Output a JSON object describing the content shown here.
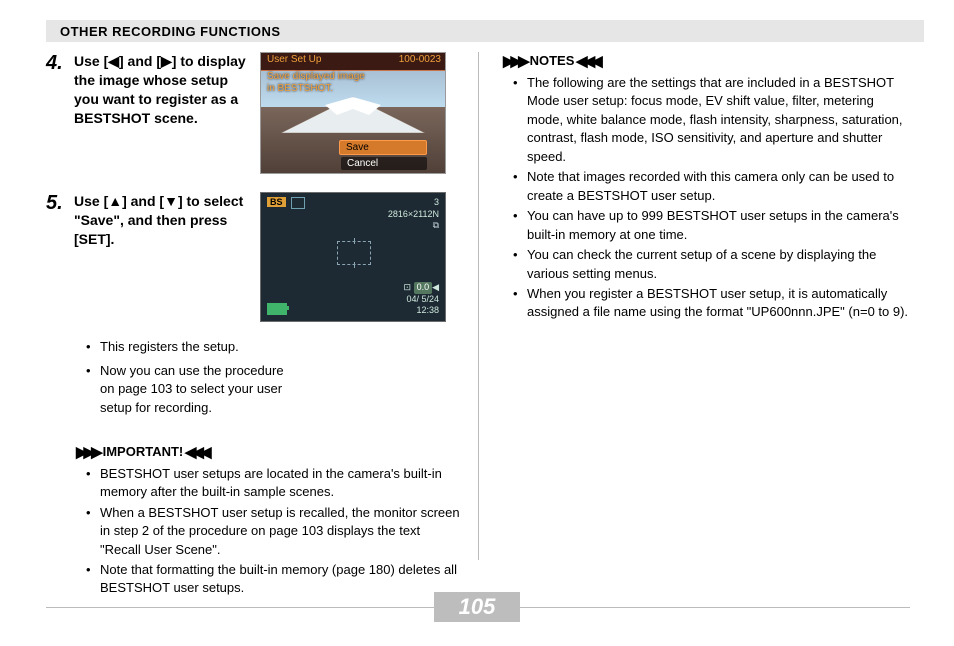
{
  "header": "OTHER RECORDING FUNCTIONS",
  "page_number": "105",
  "steps": {
    "s4": {
      "num": "4.",
      "text": "Use [◀] and [▶] to display the image whose setup you want to register as a BESTSHOT scene."
    },
    "s5": {
      "num": "5.",
      "text": "Use [▲] and [▼] to select \"Save\", and then press [SET].",
      "bullets": [
        "This registers the setup.",
        "Now you can use the procedure on page 103 to select your user setup for recording."
      ]
    }
  },
  "thumb4": {
    "top_left": "User Set Up",
    "top_right": "100-0023",
    "line1": "Save displayed image",
    "line2": "in BESTSHOT.",
    "save": "Save",
    "cancel": "Cancel"
  },
  "thumb5": {
    "bs": "BS",
    "shots": "3",
    "res": "2816×2112",
    "quality": "N",
    "card_icon": "⧉",
    "ev": "0.0",
    "date": "04/ 5/24",
    "time": "12:38"
  },
  "important": {
    "label": "IMPORTANT!",
    "items": [
      "BESTSHOT user setups are located in the camera's built-in memory after the built-in sample scenes.",
      "When a BESTSHOT user setup is recalled, the monitor screen in step 2 of the procedure on page 103 displays the text \"Recall User Scene\".",
      "Note that formatting the built-in memory (page 180) deletes all BESTSHOT user setups."
    ]
  },
  "notes": {
    "label": "NOTES",
    "items": [
      "The following are the settings that are included in a BESTSHOT Mode user setup: focus mode, EV shift value, filter, metering mode, white balance mode, flash intensity, sharpness, saturation, contrast, flash mode, ISO sensitivity, and aperture and shutter speed.",
      "Note that images recorded with this camera only can be used to create a BESTSHOT user setup.",
      "You can have up to 999 BESTSHOT user setups in the camera's built-in memory at one time.",
      "You can check the current setup of a scene by displaying the various setting menus.",
      "When you register a BESTSHOT user setup, it is automatically assigned a file name using the format \"UP600nnn.JPE\" (n=0 to 9)."
    ]
  }
}
